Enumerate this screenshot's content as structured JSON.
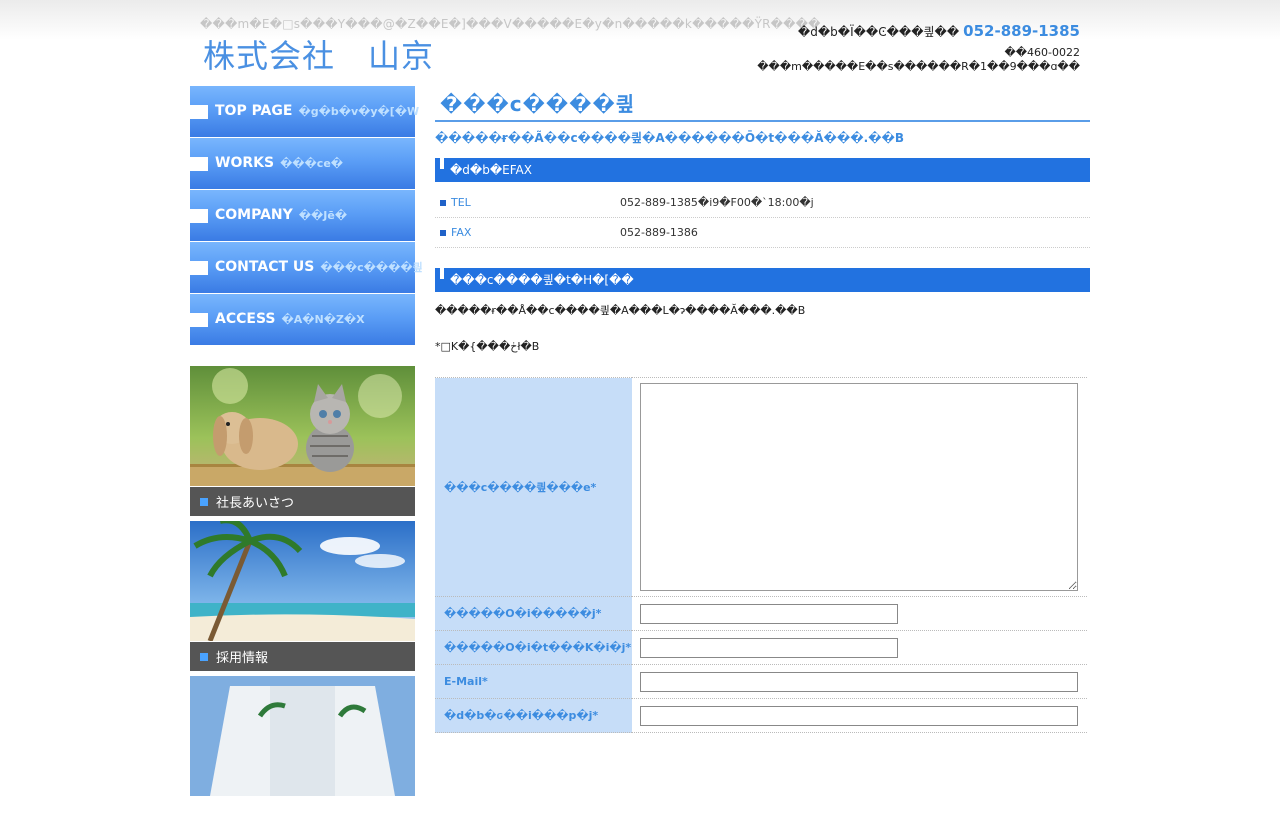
{
  "header": {
    "tagline": "���m�E�□s���Y���@�Z��E�]���V�����E�y�n�����k�����ŸR����",
    "logo": "株式会社　山京",
    "tel_label": "�d�b�Ϊ��Ͼ���킢��",
    "tel_number": "052-889-1385",
    "zip": "��460-0022",
    "address": "���m�����E��s������R�1��9���ɑ��"
  },
  "sidebar": {
    "nav": [
      {
        "label": "TOP PAGE",
        "sub": "�g�b�v�y�[�W"
      },
      {
        "label": "WORKS",
        "sub": "���ce�"
      },
      {
        "label": "COMPANY",
        "sub": "��Jē�"
      },
      {
        "label": "CONTACT US",
        "sub": "���c����킢"
      },
      {
        "label": "ACCESS",
        "sub": "�A�N�Z�X"
      }
    ],
    "banners": [
      {
        "caption": "社長あいさつ",
        "photo_icon": "rabbit-and-kitten-photo"
      },
      {
        "caption": "採用情報",
        "photo_icon": "beach-palm-photo"
      },
      {
        "caption": "",
        "photo_icon": "building-photo"
      }
    ]
  },
  "main": {
    "title": "���c����킢",
    "lead": "�����ɍ��Ã��c����킢�A������Ō�t���Ă���.��B",
    "phone_fax_heading": "�d�b�EFAX",
    "phone_fax_rows": [
      {
        "label": "TEL",
        "value": "052-889-1385�i9�F00�`18:00�j"
      },
      {
        "label": "FAX",
        "value": "052-889-1386"
      }
    ],
    "form_heading": "���c����킢�t�H�[��",
    "form_notice": "�����ɍ��Å��c����킢�A���L�ɂ����Ă���.��B",
    "required_note": "*□K�{���ڂł�B",
    "fields": [
      {
        "label": "���c����킢���e*",
        "value": ""
      },
      {
        "label": "�����O�i�����j*",
        "value": ""
      },
      {
        "label": "�����O�i�t���K�i�j*",
        "value": ""
      },
      {
        "label": "E-Mail*",
        "value": ""
      },
      {
        "label": "�d�b�ԍ��i���p�j*",
        "value": ""
      }
    ]
  },
  "colors": {
    "accent": "#3c8ce0",
    "nav_top": "#79b6fd",
    "nav_bottom": "#3a7be4",
    "section_bar": "#2272e0",
    "form_label_bg": "#c6ddf8"
  }
}
